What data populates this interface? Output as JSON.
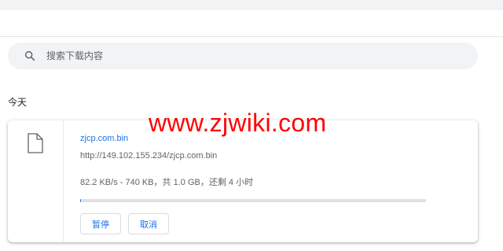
{
  "search": {
    "placeholder": "搜索下载内容",
    "icon": "search-icon"
  },
  "section": {
    "heading": "今天"
  },
  "download": {
    "file_name": "zjcp.com.bin",
    "url": "http://149.102.155.234/zjcp.com.bin",
    "status": "82.2 KB/s - 740 KB，共 1.0 GB，还剩 4 小时",
    "progress_fraction": 0.0007,
    "file_icon": "file-icon",
    "pause_label": "暂停",
    "cancel_label": "取消"
  },
  "watermark": {
    "text": "www.zjwiki.com"
  },
  "colors": {
    "accent": "#1a73e8",
    "watermark": "#ff0000",
    "search_bg": "#f1f3f4",
    "secondary_text": "#5f6368"
  }
}
